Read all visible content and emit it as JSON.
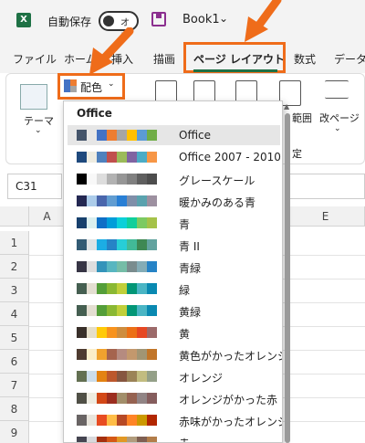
{
  "titlebar": {
    "logo": "X",
    "autosave_label": "自動保存",
    "toggle_state": "オフ",
    "book_title": "Book1",
    "caret": "⌄"
  },
  "tabs": [
    {
      "label": "ファイル"
    },
    {
      "label": "ホーム"
    },
    {
      "label": "挿入"
    },
    {
      "label": "描画"
    },
    {
      "label": "ページ レイアウト"
    },
    {
      "label": "数式"
    },
    {
      "label": "データ"
    }
  ],
  "ribbon": {
    "theme_label": "テーマ",
    "colors_label": "配色",
    "margin_label": "範囲",
    "pagebreak_label": "改ページ",
    "group_label": "定"
  },
  "namebox": {
    "value": "C31"
  },
  "grid": {
    "col_e": "E",
    "col_a": "A",
    "rows": [
      "1",
      "2",
      "3",
      "4",
      "5",
      "6",
      "7",
      "8",
      "9"
    ]
  },
  "dropdown": {
    "header": "Office",
    "items": [
      {
        "label": "Office",
        "colors": [
          "#44546a",
          "#e7e6e6",
          "#4472c4",
          "#ed7d31",
          "#a5a5a5",
          "#ffc000",
          "#5b9bd5",
          "#70ad47"
        ]
      },
      {
        "label": "Office 2007 - 2010",
        "colors": [
          "#1f497d",
          "#eeece1",
          "#4f81bd",
          "#c0504d",
          "#9bbb59",
          "#8064a2",
          "#4bacc6",
          "#f79646"
        ]
      },
      {
        "label": "グレースケール",
        "colors": [
          "#000000",
          "#f8f8f8",
          "#dddddd",
          "#b2b2b2",
          "#969696",
          "#808080",
          "#5f5f5f",
          "#4d4d4d"
        ]
      },
      {
        "label": "暖かみのある青",
        "colors": [
          "#242852",
          "#acccea",
          "#4a66ac",
          "#629dd1",
          "#297fd5",
          "#7f8fa9",
          "#5aa2ae",
          "#9d90a0"
        ]
      },
      {
        "label": "青",
        "colors": [
          "#17406d",
          "#dbefef",
          "#0f6fc6",
          "#009dd9",
          "#0bd0d9",
          "#10cf9b",
          "#7cca62",
          "#a5c249"
        ]
      },
      {
        "label": "青 II",
        "colors": [
          "#335b74",
          "#dfe3e5",
          "#1cade4",
          "#2683c6",
          "#27ced7",
          "#42ba97",
          "#3e8853",
          "#62a39f"
        ]
      },
      {
        "label": "青緑",
        "colors": [
          "#373545",
          "#dedede",
          "#3494ba",
          "#58b6c0",
          "#75bda7",
          "#7a8c8e",
          "#84acb6",
          "#2683c6"
        ]
      },
      {
        "label": "緑",
        "colors": [
          "#455f51",
          "#e3ded1",
          "#549e39",
          "#8ab833",
          "#c0cf3a",
          "#029676",
          "#4ab5c4",
          "#0989b1"
        ]
      },
      {
        "label": "黄緑",
        "colors": [
          "#455f51",
          "#e3ded1",
          "#549e39",
          "#8ab833",
          "#c0cf3a",
          "#029676",
          "#4ab5c4",
          "#0989b1"
        ]
      },
      {
        "label": "黄",
        "colors": [
          "#39302a",
          "#e5dec9",
          "#ffca08",
          "#f8931d",
          "#ce8d3e",
          "#ec7016",
          "#e64823",
          "#9c6a6a"
        ]
      },
      {
        "label": "黄色がかったオレンジ",
        "colors": [
          "#4e3b30",
          "#fbeec9",
          "#f0a22e",
          "#a5644e",
          "#b58b80",
          "#c3986d",
          "#a19574",
          "#c17529"
        ]
      },
      {
        "label": "オレンジ",
        "colors": [
          "#637052",
          "#ccddea",
          "#e48312",
          "#bd582c",
          "#865640",
          "#9b8357",
          "#c2bc80",
          "#94a088"
        ]
      },
      {
        "label": "オレンジがかった赤",
        "colors": [
          "#505046",
          "#eeece1",
          "#d34817",
          "#9b2d1f",
          "#a28e6a",
          "#956251",
          "#918485",
          "#855d5d"
        ]
      },
      {
        "label": "赤味がかったオレンジ",
        "colors": [
          "#696464",
          "#e9e5dc",
          "#e84c22",
          "#ffbd47",
          "#b64926",
          "#ff8427",
          "#cc9900",
          "#b22600"
        ]
      },
      {
        "label": "赤",
        "colors": [
          "#454551",
          "#d8d9dc",
          "#a5300f",
          "#d55816",
          "#e19825",
          "#b19c7d",
          "#7f5f52",
          "#b27d49"
        ]
      }
    ],
    "selected_index": 0
  },
  "colors": {
    "accent_orange": "#ef6c1a",
    "excel_green": "#1e7145"
  }
}
